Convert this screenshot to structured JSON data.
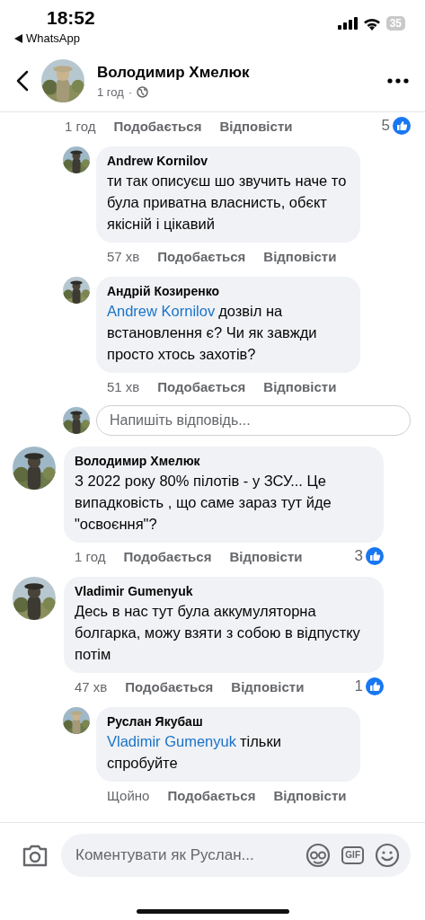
{
  "status_bar": {
    "time": "18:52",
    "back_app": "WhatsApp",
    "battery": "35"
  },
  "header": {
    "name": "Володимир Хмелюк",
    "meta": "1 год",
    "separator": "·"
  },
  "threads": [
    {
      "actions": {
        "time": "1 год",
        "like": "Подобається",
        "reply": "Відповісти",
        "reactions": "5"
      },
      "children": [
        {
          "author": "Andrew Kornilov",
          "text": "ти так описуєш шо звучить наче то була приватна власнисть, обєкт якісній і цікавий",
          "actions": {
            "time": "57 хв",
            "like": "Подобається",
            "reply": "Відповісти"
          }
        },
        {
          "author": "Андрій Козиренко",
          "mention": "Andrew Kornilov",
          "text": "дозвіл на встановлення є? Чи як завжди просто хтось захотів?",
          "actions": {
            "time": "51 хв",
            "like": "Подобається",
            "reply": "Відповісти"
          }
        }
      ],
      "reply_field": {
        "placeholder": "Напишіть відповідь..."
      }
    },
    {
      "author": "Володимир Хмелюк",
      "text": "З 2022 року 80% пілотів - у ЗСУ... Це випадковість , що саме зараз тут йде \"освоєння\"?",
      "actions": {
        "time": "1 год",
        "like": "Подобається",
        "reply": "Відповісти",
        "reactions": "3"
      }
    },
    {
      "author": "Vladimir Gumenyuk",
      "text": "Десь в нас тут була аккумуляторна болгарка, можу взяти з собою в відпустку потім",
      "actions": {
        "time": "47 хв",
        "like": "Подобається",
        "reply": "Відповісти",
        "reactions": "1"
      },
      "children": [
        {
          "author": "Руслан Якубаш",
          "mention": "Vladimir Gumenyuk",
          "text": "тільки спробуйте",
          "actions": {
            "time": "Щойно",
            "like": "Подобається",
            "reply": "Відповісти"
          }
        }
      ]
    }
  ],
  "composer": {
    "placeholder": "Коментувати як Руслан...",
    "gif_label": "GIF"
  }
}
